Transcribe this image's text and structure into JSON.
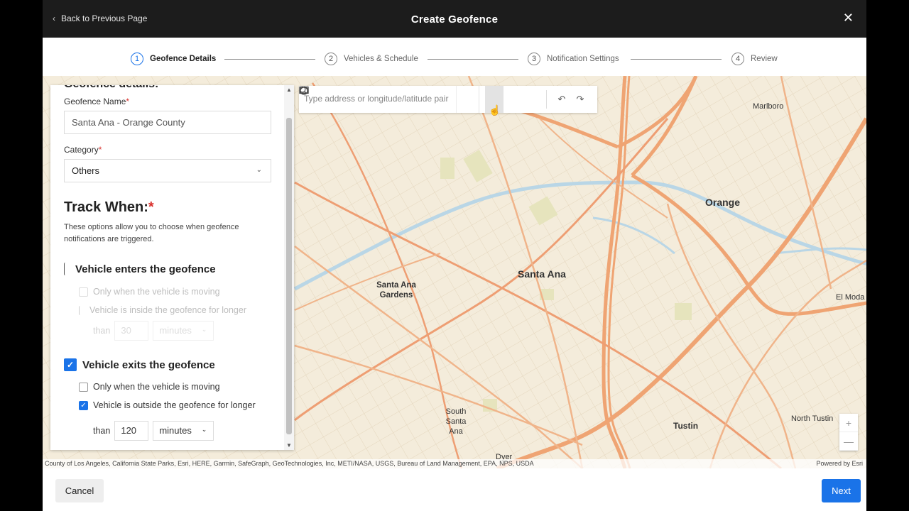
{
  "header": {
    "back_label": "Back to Previous Page",
    "title": "Create Geofence",
    "close_icon": "close-icon"
  },
  "stepper": {
    "steps": [
      {
        "num": "1",
        "label": "Geofence Details",
        "active": true
      },
      {
        "num": "2",
        "label": "Vehicles & Schedule",
        "active": false
      },
      {
        "num": "3",
        "label": "Notification Settings",
        "active": false
      },
      {
        "num": "4",
        "label": "Review",
        "active": false
      }
    ]
  },
  "panel": {
    "section_title": "Geofence details:",
    "name_label": "Geofence Name",
    "name_value": "Santa Ana - Orange County",
    "category_label": "Category",
    "category_value": "Others",
    "required_mark": "*",
    "track_title": "Track When:",
    "track_desc": "These options allow you to choose when geofence notifications are triggered.",
    "enters": {
      "label": "Vehicle enters the geofence",
      "checked": false,
      "opt_moving": "Only when the vehicle is moving",
      "opt_inside": "Vehicle is inside the geofence for longer",
      "than": "than",
      "duration": "30",
      "unit": "minutes"
    },
    "exits": {
      "label": "Vehicle exits the geofence",
      "checked": true,
      "opt_moving": "Only when the vehicle is moving",
      "opt_moving_checked": false,
      "opt_outside": "Vehicle is outside the geofence for longer",
      "opt_outside_checked": true,
      "than": "than",
      "duration": "120",
      "unit": "minutes"
    }
  },
  "map": {
    "search_placeholder": "Type address or longitude/latitude pair",
    "tools": [
      "search-icon",
      "polygon-icon",
      "rectangle-icon",
      "circle-icon",
      "undo-icon",
      "redo-icon"
    ],
    "labels": {
      "santa_ana": "Santa Ana",
      "orange": "Orange",
      "santa_ana_gardens": "Santa Ana Gardens",
      "south_santa_ana": "South Santa Ana",
      "tustin": "Tustin",
      "north_tustin": "North Tustin",
      "marlboro": "Marlboro",
      "el_modena": "El Moda",
      "dyer": "Dyer"
    },
    "zoom_in": "+",
    "zoom_out": "—",
    "attribution": "County of Los Angeles, California State Parks, Esri, HERE, Garmin, SafeGraph, GeoTechnologies, Inc, METI/NASA, USGS, Bureau of Land Management, EPA, NPS, USDA",
    "powered_by": "Powered by Esri"
  },
  "footer": {
    "cancel_label": "Cancel",
    "next_label": "Next"
  }
}
